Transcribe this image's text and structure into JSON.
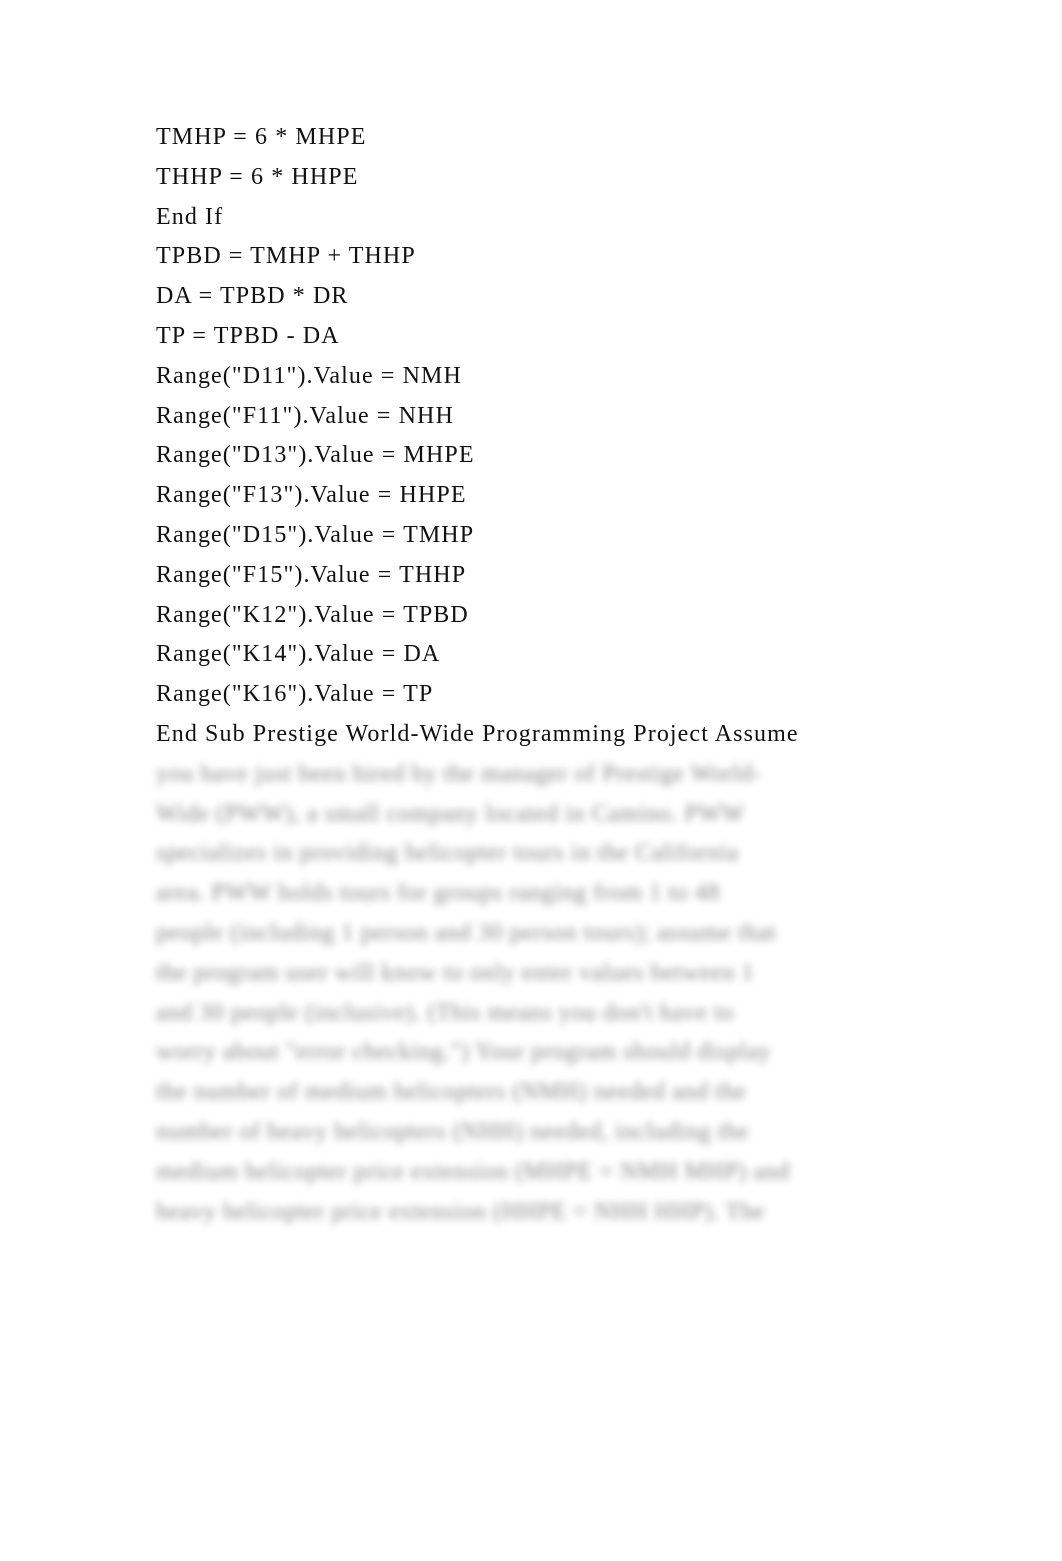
{
  "document": {
    "code_lines": [
      "TMHP = 6 * MHPE",
      "THHP = 6 * HHPE",
      "End If",
      "TPBD = TMHP + THHP",
      "DA = TPBD * DR",
      "TP = TPBD - DA",
      "Range(\"D11\").Value = NMH",
      "Range(\"F11\").Value = NHH",
      "Range(\"D13\").Value = MHPE",
      "Range(\"F13\").Value = HHPE",
      "Range(\"D15\").Value = TMHP",
      "Range(\"F15\").Value = THHP",
      "Range(\"K12\").Value = TPBD",
      "Range(\"K14\").Value = DA",
      "Range(\"K16\").Value = TP"
    ],
    "heading_line": "End Sub Prestige World-Wide Programming Project Assume",
    "blurred_lines": [
      "you have just been hired by the manager of Prestige World-",
      "Wide (PWW), a small company located in Camino. PWW",
      "specializes in providing helicopter tours in the California",
      "area. PWW holds tours for groups ranging from 1 to 48",
      "people (including 1 person and 30 person tours); assume that",
      "the program user will know to only enter values between 1",
      "and 30 people (inclusive). (This means you don't have to",
      "worry about \"error checking.\") Your program should display",
      "the number of medium helicopters (NMH) needed and the",
      "number of heavy helicopters (NHH) needed, including the",
      "medium helicopter price extension (MHPE = NMH MHP) and",
      "heavy helicopter price extension (HHPE = NHH HHP). The"
    ]
  }
}
